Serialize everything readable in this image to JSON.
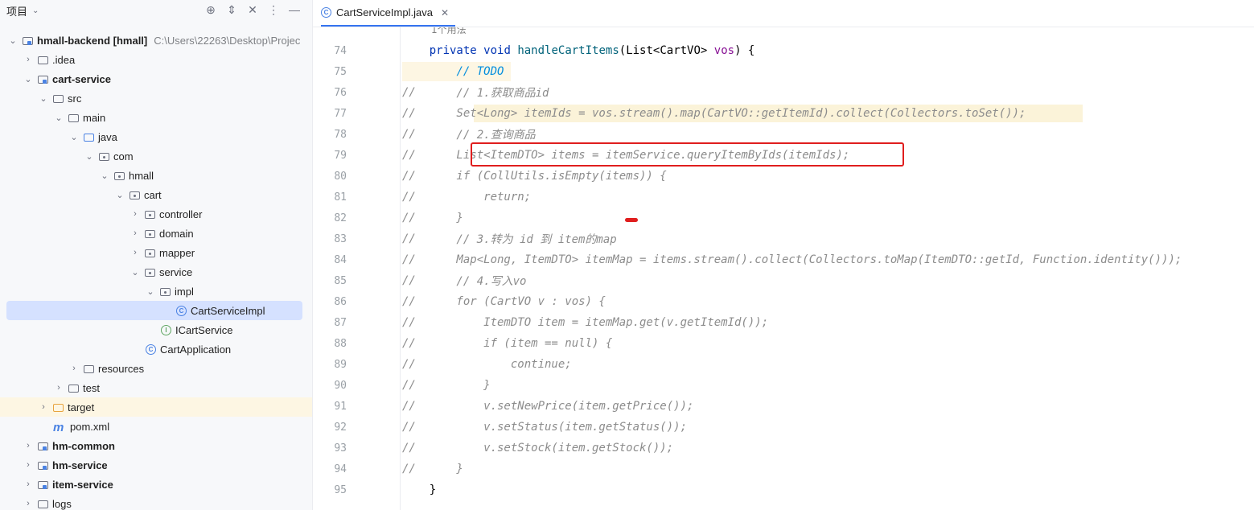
{
  "sidebar": {
    "title": "项目",
    "tree": [
      {
        "label": "hmall-backend [hmall]",
        "path": "C:\\Users\\22263\\Desktop\\Projec"
      },
      {
        "label": ".idea"
      },
      {
        "label": "cart-service"
      },
      {
        "label": "src"
      },
      {
        "label": "main"
      },
      {
        "label": "java"
      },
      {
        "label": "com"
      },
      {
        "label": "hmall"
      },
      {
        "label": "cart"
      },
      {
        "label": "controller"
      },
      {
        "label": "domain"
      },
      {
        "label": "mapper"
      },
      {
        "label": "service"
      },
      {
        "label": "impl"
      },
      {
        "label": "CartServiceImpl"
      },
      {
        "label": "ICartService"
      },
      {
        "label": "CartApplication"
      },
      {
        "label": "resources"
      },
      {
        "label": "test"
      },
      {
        "label": "target"
      },
      {
        "label": "pom.xml"
      },
      {
        "label": "hm-common"
      },
      {
        "label": "hm-service"
      },
      {
        "label": "item-service"
      },
      {
        "label": "logs"
      }
    ]
  },
  "editor": {
    "tab_label": "CartServiceImpl.java",
    "usages_hint": "1个用法",
    "lines": [
      {
        "n": "74",
        "m": "",
        "t": "    private void handleCartItems(List<CartVO> vos) {"
      },
      {
        "n": "75",
        "m": "",
        "t": "        // TODO"
      },
      {
        "n": "76",
        "m": "//",
        "t": "        // 1.获取商品id"
      },
      {
        "n": "77",
        "m": "//",
        "t": "        Set<Long> itemIds = vos.stream().map(CartVO::getItemId).collect(Collectors.toSet());"
      },
      {
        "n": "78",
        "m": "//",
        "t": "        // 2.查询商品"
      },
      {
        "n": "79",
        "m": "//",
        "t": "        List<ItemDTO> items = itemService.queryItemByIds(itemIds);"
      },
      {
        "n": "80",
        "m": "//",
        "t": "        if (CollUtils.isEmpty(items)) {"
      },
      {
        "n": "81",
        "m": "//",
        "t": "            return;"
      },
      {
        "n": "82",
        "m": "//",
        "t": "        }"
      },
      {
        "n": "83",
        "m": "//",
        "t": "        // 3.转为 id 到 item的map"
      },
      {
        "n": "84",
        "m": "//",
        "t": "        Map<Long, ItemDTO> itemMap = items.stream().collect(Collectors.toMap(ItemDTO::getId, Function.identity()));"
      },
      {
        "n": "85",
        "m": "//",
        "t": "        // 4.写入vo"
      },
      {
        "n": "86",
        "m": "//",
        "t": "        for (CartVO v : vos) {"
      },
      {
        "n": "87",
        "m": "//",
        "t": "            ItemDTO item = itemMap.get(v.getItemId());"
      },
      {
        "n": "88",
        "m": "//",
        "t": "            if (item == null) {"
      },
      {
        "n": "89",
        "m": "//",
        "t": "                continue;"
      },
      {
        "n": "90",
        "m": "//",
        "t": "            }"
      },
      {
        "n": "91",
        "m": "//",
        "t": "            v.setNewPrice(item.getPrice());"
      },
      {
        "n": "92",
        "m": "//",
        "t": "            v.setStatus(item.getStatus());"
      },
      {
        "n": "93",
        "m": "//",
        "t": "            v.setStock(item.getStock());"
      },
      {
        "n": "94",
        "m": "//",
        "t": "        }"
      },
      {
        "n": "95",
        "m": "",
        "t": "    }"
      }
    ]
  }
}
